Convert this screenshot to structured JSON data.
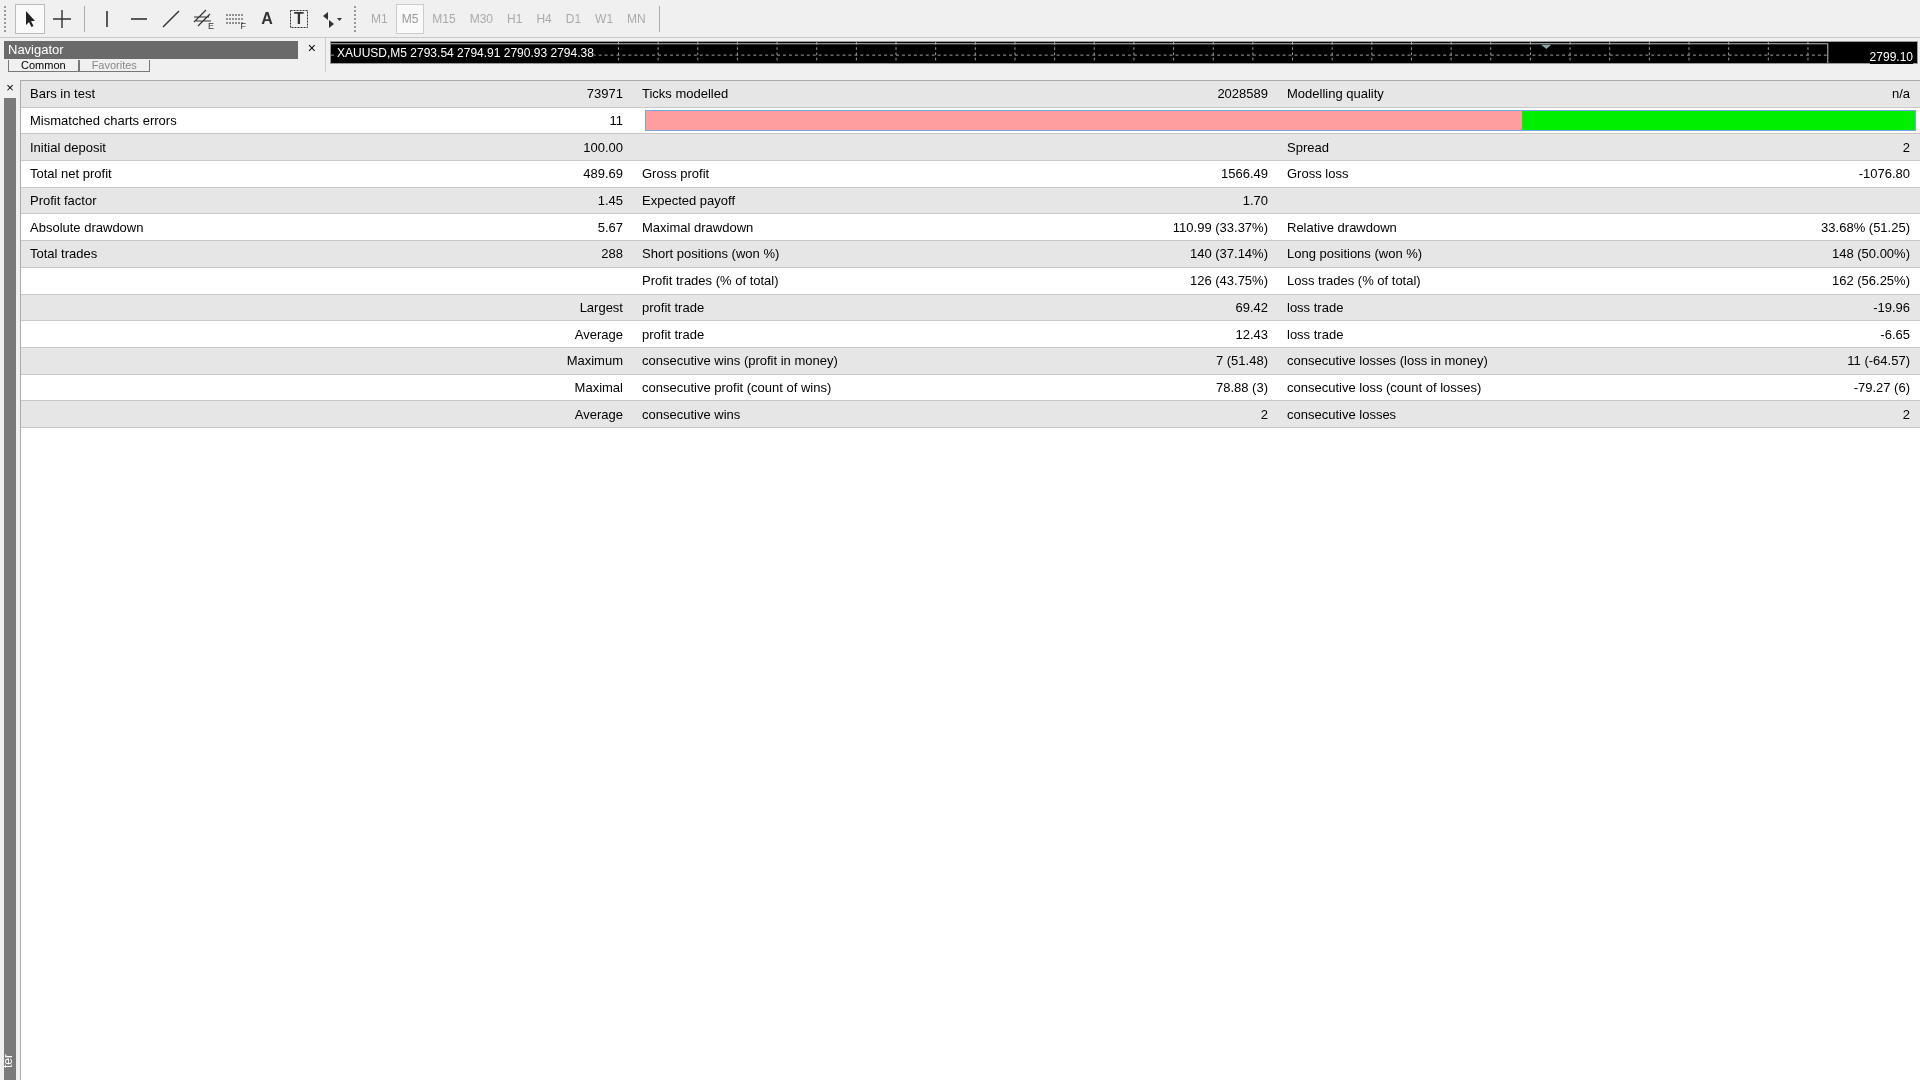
{
  "toolbar": {
    "tools": [
      {
        "kind": "cursor",
        "selected": true
      },
      {
        "kind": "crosshair",
        "selected": false
      },
      {
        "kind": "vline",
        "selected": false
      },
      {
        "kind": "hline",
        "selected": false
      },
      {
        "kind": "trend",
        "selected": false
      },
      {
        "kind": "channel",
        "selected": false,
        "letter": "E"
      },
      {
        "kind": "fibo",
        "selected": false,
        "letter": "F"
      },
      {
        "kind": "text",
        "selected": false,
        "letter": "A"
      },
      {
        "kind": "label",
        "selected": false,
        "letter": "T"
      },
      {
        "kind": "arrows",
        "selected": false
      }
    ],
    "timeframes": [
      {
        "label": "M1",
        "selected": false
      },
      {
        "label": "M5",
        "selected": true
      },
      {
        "label": "M15",
        "selected": false
      },
      {
        "label": "M30",
        "selected": false
      },
      {
        "label": "H1",
        "selected": false
      },
      {
        "label": "H4",
        "selected": false
      },
      {
        "label": "D1",
        "selected": false
      },
      {
        "label": "W1",
        "selected": false
      },
      {
        "label": "MN",
        "selected": false
      }
    ]
  },
  "navigator": {
    "title": "Navigator",
    "close": "×",
    "tabs": [
      {
        "label": "Common",
        "selected": true
      },
      {
        "label": "Favorites",
        "selected": false
      }
    ]
  },
  "chart": {
    "symbol": "XAUUSD,M5",
    "ohlc": "2793.54 2794.91 2790.93 2794.38",
    "price": "2799.10"
  },
  "tester": {
    "close": "×",
    "side_label": "ter"
  },
  "report": {
    "rows": [
      {
        "kind": "values",
        "columns": [
          {
            "label": "Bars in test",
            "value": "73971"
          },
          {
            "label": "Ticks modelled",
            "value": "2028589"
          },
          {
            "label": "Modelling quality",
            "value": "n/a"
          }
        ]
      },
      {
        "kind": "quality-bar",
        "columns": [
          {
            "label": "Mismatched charts errors",
            "value": "11"
          }
        ],
        "level": 0.31
      },
      {
        "kind": "values",
        "columns": [
          {
            "label": "Initial deposit",
            "value": "100.00"
          },
          {},
          {
            "label": "Spread",
            "value": "2"
          }
        ]
      },
      {
        "kind": "values",
        "columns": [
          {
            "label": "Total net profit",
            "value": "489.69"
          },
          {
            "label": "Gross profit",
            "value": "1566.49"
          },
          {
            "label": "Gross loss",
            "value": "-1076.80"
          }
        ]
      },
      {
        "kind": "values",
        "columns": [
          {
            "label": "Profit factor",
            "value": "1.45"
          },
          {
            "label": "Expected payoff",
            "value": "1.70"
          },
          {}
        ]
      },
      {
        "kind": "values",
        "columns": [
          {
            "label": "Absolute drawdown",
            "value": "5.67"
          },
          {
            "label": "Maximal drawdown",
            "value": "110.99 (33.37%)"
          },
          {
            "label": "Relative drawdown",
            "value": "33.68% (51.25)"
          }
        ]
      },
      {
        "kind": "values",
        "columns": [
          {
            "label": "Total trades",
            "value": "288"
          },
          {
            "label": "Short positions (won %)",
            "value": "140 (37.14%)"
          },
          {
            "label": "Long positions (won %)",
            "value": "148 (50.00%)"
          }
        ]
      },
      {
        "kind": "values",
        "columns": [
          {},
          {
            "label": "Profit trades (% of total)",
            "value": "126 (43.75%)"
          },
          {
            "label": "Loss trades (% of total)",
            "value": "162 (56.25%)"
          }
        ]
      },
      {
        "kind": "group",
        "caption": "Largest",
        "columns": [
          {
            "label": "profit trade",
            "value": "69.42"
          },
          {
            "label": "loss trade",
            "value": "-19.96"
          }
        ]
      },
      {
        "kind": "group",
        "caption": "Average",
        "columns": [
          {
            "label": "profit trade",
            "value": "12.43"
          },
          {
            "label": "loss trade",
            "value": "-6.65"
          }
        ]
      },
      {
        "kind": "group",
        "caption": "Maximum",
        "columns": [
          {
            "label": "consecutive wins (profit in money)",
            "value": "7 (51.48)"
          },
          {
            "label": "consecutive losses (loss in money)",
            "value": "11 (-64.57)"
          }
        ]
      },
      {
        "kind": "group",
        "caption": "Maximal",
        "columns": [
          {
            "label": "consecutive profit (count of wins)",
            "value": "78.88 (3)"
          },
          {
            "label": "consecutive loss (count of losses)",
            "value": "-79.27 (6)"
          }
        ]
      },
      {
        "kind": "group",
        "caption": "Average",
        "columns": [
          {
            "label": "consecutive wins",
            "value": "2"
          },
          {
            "label": "consecutive losses",
            "value": "2"
          }
        ]
      }
    ]
  }
}
